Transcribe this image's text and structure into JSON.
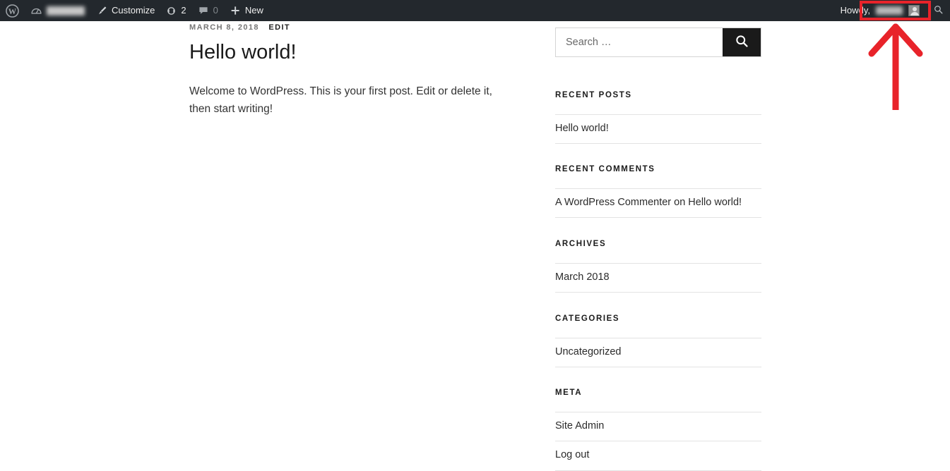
{
  "adminbar": {
    "wp_logo_icon": "wordpress-logo-icon",
    "site_icon": "dashboard-speedometer-icon",
    "site_name_redacted": "",
    "customize_icon": "paintbrush-icon",
    "customize_label": "Customize",
    "updates_icon": "updates-refresh-icon",
    "updates_count": "2",
    "comments_icon": "comment-bubble-icon",
    "comments_count": "0",
    "new_icon": "plus-icon",
    "new_label": "New",
    "howdy_label": "Howdy,",
    "user_name_redacted": "",
    "avatar_icon": "user-avatar-icon",
    "search_icon": "search-icon",
    "background_color": "#23282d"
  },
  "annotation": {
    "highlight_color": "#e8232a",
    "arrow_icon": "up-arrow-annotation-icon",
    "target": "howdy-user-menu"
  },
  "post": {
    "date": "MARCH 8, 2018",
    "edit_label": "EDIT",
    "title": "Hello world!",
    "body": "Welcome to WordPress. This is your first post. Edit or delete it, then start writing!"
  },
  "sidebar": {
    "search": {
      "placeholder": "Search …",
      "value": "",
      "submit_icon": "search-icon",
      "button_color": "#1a1a1a"
    },
    "widgets": [
      {
        "title": "RECENT POSTS",
        "items": [
          "Hello world!"
        ]
      },
      {
        "title": "RECENT COMMENTS",
        "items": [
          "A WordPress Commenter on Hello world!"
        ]
      },
      {
        "title": "ARCHIVES",
        "items": [
          "March 2018"
        ]
      },
      {
        "title": "CATEGORIES",
        "items": [
          "Uncategorized"
        ]
      },
      {
        "title": "META",
        "items": [
          "Site Admin",
          "Log out"
        ]
      }
    ]
  }
}
